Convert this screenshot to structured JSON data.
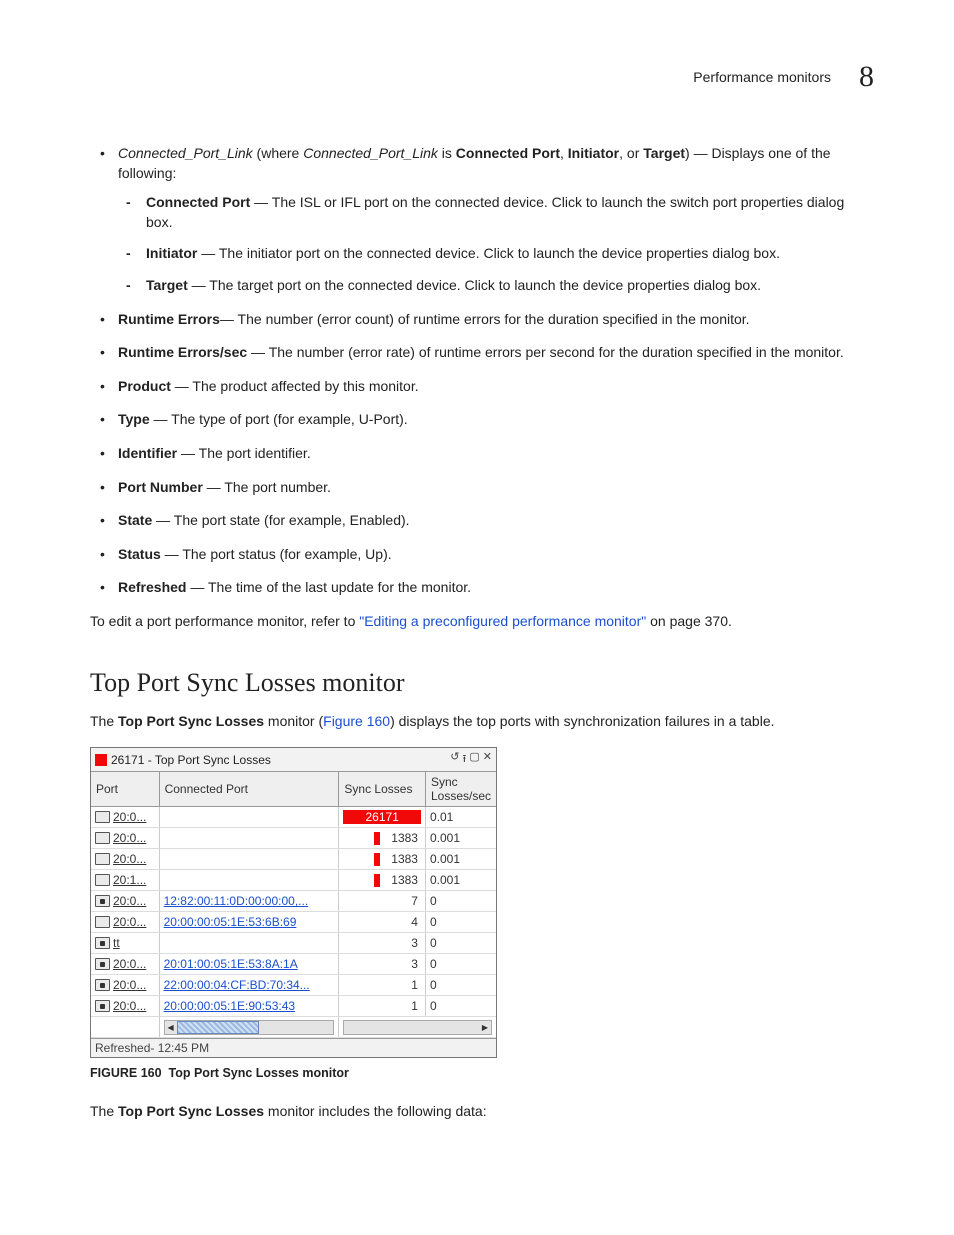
{
  "header": {
    "section_name": "Performance monitors",
    "chapter_number": "8"
  },
  "list1": {
    "cpl": {
      "term": "Connected_Port_Link",
      "mid": " (where ",
      "term2": "Connected_Port_Link",
      "mid2": " is ",
      "o1": "Connected Port",
      "sep1": ", ",
      "o2": "Initiator",
      "sep2": ", or ",
      "o3": "Target",
      "tail": ") — Displays one of the following:",
      "sub": {
        "cp_b": "Connected Port",
        "cp_t": " — The ISL or IFL port on the connected device. Click to launch the switch port properties dialog box.",
        "in_b": "Initiator",
        "in_t": " — The initiator port on the connected device. Click to launch the device properties dialog box.",
        "tg_b": "Target",
        "tg_t": " — The target port on the connected device. Click to launch the device properties dialog box."
      }
    },
    "re_b": "Runtime Errors",
    "re_t": "— The number (error count) of runtime errors for the duration specified in the monitor.",
    "res_b": "Runtime Errors/sec",
    "res_t": " — The number (error rate) of runtime errors per second for the duration specified in the monitor.",
    "pr_b": "Product",
    "pr_t": " — The product affected by this monitor.",
    "ty_b": "Type",
    "ty_t": " — The type of port (for example, U-Port).",
    "id_b": "Identifier",
    "id_t": " — The port identifier.",
    "pn_b": "Port Number",
    "pn_t": " — The port number.",
    "st_b": "State",
    "st_t": " — The port state (for example, Enabled).",
    "su_b": "Status",
    "su_t": " — The port status (for example, Up).",
    "rf_b": "Refreshed",
    "rf_t": " — The time of the last update for the monitor."
  },
  "edit_text1": "To edit a port performance monitor, refer to ",
  "edit_link": "\"Editing a preconfigured performance monitor\"",
  "edit_text2": " on page 370.",
  "h2": "Top Port Sync Losses monitor",
  "intro": {
    "t1": "The ",
    "b1": "Top Port Sync Losses",
    "t2": " monitor (",
    "link": "Figure 160",
    "t3": ") displays the top ports with synchronization failures in a table."
  },
  "widget": {
    "title": "26171 - Top Port Sync Losses",
    "headers": {
      "c1": "Port",
      "c2": "Connected Port",
      "c3": "Sync Losses",
      "c4": "Sync Losses/sec"
    },
    "footer": "Refreshed- 12:45 PM"
  },
  "chart_data": {
    "type": "table",
    "title": "26171 - Top Port Sync Losses",
    "columns": [
      "Port",
      "Connected Port",
      "Sync Losses",
      "Sync Losses/sec"
    ],
    "rows": [
      {
        "icon": "open",
        "port": "20:0...",
        "connected": "",
        "sync": 26171,
        "rate": "0.01",
        "bar": "full"
      },
      {
        "icon": "open",
        "port": "20:0...",
        "connected": "",
        "sync": 1383,
        "rate": "0.001",
        "bar": "small"
      },
      {
        "icon": "open",
        "port": "20:0...",
        "connected": "",
        "sync": 1383,
        "rate": "0.001",
        "bar": "small"
      },
      {
        "icon": "open",
        "port": "20:1...",
        "connected": "",
        "sync": 1383,
        "rate": "0.001",
        "bar": "small"
      },
      {
        "icon": "filled",
        "port": "20:0...",
        "connected": "12:82:00:11:0D:00:00:00,...",
        "sync": 7,
        "rate": "0",
        "bar": "none"
      },
      {
        "icon": "open",
        "port": "20:0...",
        "connected": "20:00:00:05:1E:53:6B:69",
        "sync": 4,
        "rate": "0",
        "bar": "none"
      },
      {
        "icon": "filled",
        "port": "tt",
        "connected": "",
        "sync": 3,
        "rate": "0",
        "bar": "none"
      },
      {
        "icon": "filled",
        "port": "20:0...",
        "connected": "20:01:00:05:1E:53:8A:1A",
        "sync": 3,
        "rate": "0",
        "bar": "none"
      },
      {
        "icon": "filled",
        "port": "20:0...",
        "connected": "22:00:00:04:CF:BD:70:34...",
        "sync": 1,
        "rate": "0",
        "bar": "none"
      },
      {
        "icon": "filled",
        "port": "20:0...",
        "connected": "20:00:00:05:1E:90:53:43",
        "sync": 1,
        "rate": "0",
        "bar": "none"
      }
    ],
    "refreshed": "12:45 PM"
  },
  "figcap": {
    "num": "FIGURE 160",
    "text": "Top Port Sync Losses monitor"
  },
  "outro": {
    "t1": "The ",
    "b1": "Top Port Sync Losses",
    "t2": " monitor includes the following data:"
  }
}
